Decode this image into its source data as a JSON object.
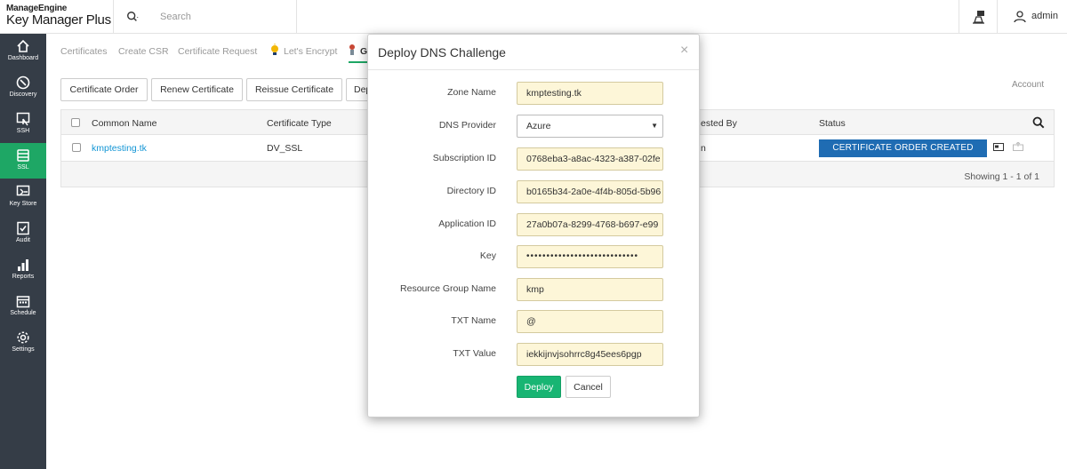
{
  "header": {
    "brand": "ManageEngine",
    "product": "Key Manager Plus",
    "search_placeholder": "Search",
    "user": "admin"
  },
  "sidebar": {
    "items": [
      {
        "label": "Dashboard",
        "icon": "home-icon"
      },
      {
        "label": "Discovery",
        "icon": "discovery-icon"
      },
      {
        "label": "SSH",
        "icon": "ssh-icon"
      },
      {
        "label": "SSL",
        "icon": "ssl-icon",
        "active": true
      },
      {
        "label": "Key Store",
        "icon": "key-store-icon"
      },
      {
        "label": "Audit",
        "icon": "audit-icon"
      },
      {
        "label": "Reports",
        "icon": "reports-icon"
      },
      {
        "label": "Schedule",
        "icon": "calendar-icon"
      },
      {
        "label": "Settings",
        "icon": "gear-icon"
      }
    ]
  },
  "subnav": {
    "tabs": [
      "Certificates",
      "Create CSR",
      "Certificate Request",
      "Let's Encrypt",
      "G"
    ]
  },
  "toolbar": {
    "buttons": [
      "Certificate Order",
      "Renew Certificate",
      "Reissue Certificate",
      "Dep"
    ],
    "account": "Account"
  },
  "table": {
    "columns": [
      "Common Name",
      "Certificate Type",
      "ested By",
      "Status"
    ],
    "rows": [
      {
        "common_name": "kmptesting.tk",
        "type": "DV_SSL",
        "requested_by": "n",
        "status": "CERTIFICATE ORDER CREATED"
      }
    ],
    "footer": "Showing 1 - 1 of 1"
  },
  "modal": {
    "title": "Deploy DNS Challenge",
    "close": "×",
    "fields": [
      {
        "label": "Zone Name",
        "value": "kmptesting.tk"
      },
      {
        "label": "DNS Provider",
        "value": "Azure"
      },
      {
        "label": "Subscription ID",
        "value": "0768eba3-a8ac-4323-a387-02fe"
      },
      {
        "label": "Directory ID",
        "value": "b0165b34-2a0e-4f4b-805d-5b96"
      },
      {
        "label": "Application ID",
        "value": "27a0b07a-8299-4768-b697-e99"
      },
      {
        "label": "Key",
        "value": "••••••••••••••••••••••••••••"
      },
      {
        "label": "Resource Group Name",
        "value": "kmp"
      },
      {
        "label": "TXT Name",
        "value": "@"
      },
      {
        "label": "TXT Value",
        "value": "iekkijnvjsohrrc8g45ees6pgp"
      }
    ],
    "deploy_label": "Deploy",
    "cancel_label": "Cancel"
  },
  "colors": {
    "sidebar": "#353d47",
    "sidebar_active": "#1ea765",
    "status_badge": "#1f6cb3",
    "deploy": "#18b573",
    "field_bg": "#fdf6d8",
    "link": "#1496d5"
  }
}
